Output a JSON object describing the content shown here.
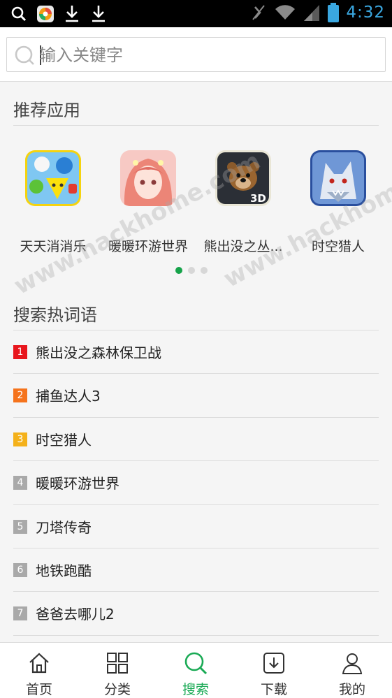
{
  "status_bar": {
    "time": "4:32",
    "left_icons": [
      "search-icon",
      "app-center-icon",
      "download-icon",
      "download-icon"
    ],
    "right_icons": [
      "mute-icon",
      "wifi-icon",
      "signal-icon",
      "battery-icon"
    ]
  },
  "search": {
    "placeholder": "输入关键字",
    "value": ""
  },
  "recommended": {
    "title": "推荐应用",
    "apps": [
      {
        "name": "天天消消乐",
        "icon": "match-game-icon"
      },
      {
        "name": "暖暖环游世界",
        "icon": "dressup-girl-icon"
      },
      {
        "name": "熊出没之丛...",
        "icon": "bear-3d-icon"
      },
      {
        "name": "时空猎人",
        "icon": "wolf-hunter-icon"
      }
    ],
    "pager": {
      "count": 3,
      "active": 0
    }
  },
  "watermark": "www.hackhome.com",
  "hot_words": {
    "title": "搜索热词语",
    "items": [
      {
        "rank": "1",
        "label": "熊出没之森林保卫战",
        "color": "#e8161d"
      },
      {
        "rank": "2",
        "label": "捕鱼达人3",
        "color": "#f5731c"
      },
      {
        "rank": "3",
        "label": "时空猎人",
        "color": "#f4b11a"
      },
      {
        "rank": "4",
        "label": "暖暖环游世界",
        "color": "#a9a9a9"
      },
      {
        "rank": "5",
        "label": "刀塔传奇",
        "color": "#a9a9a9"
      },
      {
        "rank": "6",
        "label": "地铁跑酷",
        "color": "#a9a9a9"
      },
      {
        "rank": "7",
        "label": "爸爸去哪儿2",
        "color": "#a9a9a9"
      }
    ]
  },
  "bottom_nav": {
    "active_color": "#1aaa55",
    "items": [
      {
        "label": "首页",
        "icon": "home-icon"
      },
      {
        "label": "分类",
        "icon": "grid-icon"
      },
      {
        "label": "搜索",
        "icon": "search-icon"
      },
      {
        "label": "下载",
        "icon": "download-icon"
      },
      {
        "label": "我的",
        "icon": "user-icon"
      }
    ],
    "active_index": 2
  }
}
